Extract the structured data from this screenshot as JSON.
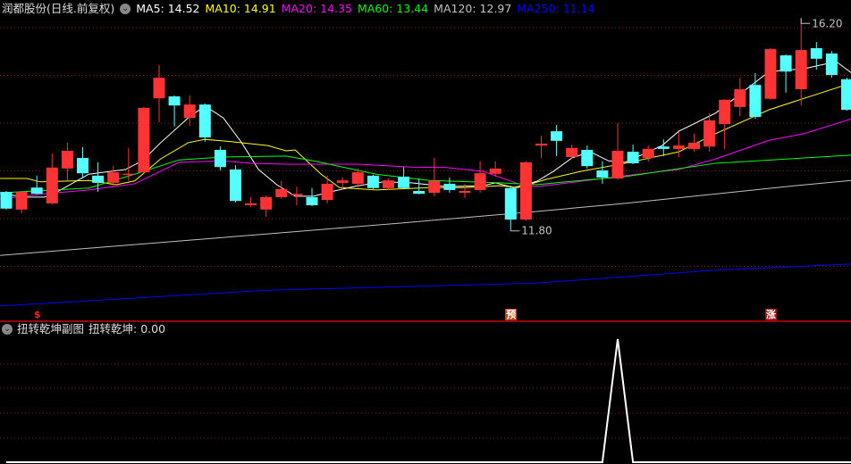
{
  "header": {
    "title": "润都股份(日线.前复权)",
    "ma": [
      {
        "label": "MA5: 14.52",
        "color": "#ffffff"
      },
      {
        "label": "MA10: 14.91",
        "color": "#ffff00"
      },
      {
        "label": "MA20: 14.35",
        "color": "#ff00ff"
      },
      {
        "label": "MA60: 13.44",
        "color": "#00ff00"
      },
      {
        "label": "MA120: 12.97",
        "color": "#c0c0c0"
      },
      {
        "label": "MA250: 11.14",
        "color": "#0000ff"
      }
    ]
  },
  "sub_header": {
    "title": "扭转乾坤副图",
    "value_label": "扭转乾坤: 0.00"
  },
  "markers": [
    {
      "text": "$",
      "index": 2,
      "color": "#ff2020",
      "bg": ""
    },
    {
      "text": "预",
      "index": 33,
      "color": "#ffffff",
      "bg": "#c04010"
    },
    {
      "text": "涨",
      "index": 50,
      "color": "#ffffff",
      "bg": "#a01010"
    }
  ],
  "colors": {
    "up": "#ff3333",
    "down": "#54ffff",
    "grid": "#8b1a1a",
    "separator": "#cc0000"
  },
  "chart_data": {
    "type": "candlestick",
    "price_range": [
      10.0,
      16.2
    ],
    "grid_prices": [
      16,
      15,
      14,
      13,
      12,
      11
    ],
    "annotations": [
      {
        "text": "16.20",
        "index": 52,
        "price": 16.2
      },
      {
        "text": "11.80",
        "index": 33,
        "price": 11.8
      }
    ],
    "ohlc": [
      [
        12.56,
        12.58,
        12.19,
        12.21
      ],
      [
        12.19,
        12.58,
        12.11,
        12.56
      ],
      [
        12.65,
        12.9,
        12.51,
        12.52
      ],
      [
        12.32,
        13.37,
        12.3,
        13.07
      ],
      [
        13.05,
        13.59,
        12.79,
        13.42
      ],
      [
        13.27,
        13.5,
        12.84,
        12.95
      ],
      [
        12.9,
        13.18,
        12.56,
        12.75
      ],
      [
        12.75,
        13.1,
        12.67,
        12.97
      ],
      [
        12.92,
        13.48,
        12.79,
        12.94
      ],
      [
        12.97,
        14.34,
        12.95,
        14.32
      ],
      [
        14.52,
        15.22,
        14.02,
        14.95
      ],
      [
        14.56,
        14.58,
        13.93,
        14.37
      ],
      [
        14.11,
        14.58,
        13.94,
        14.39
      ],
      [
        14.39,
        14.41,
        13.61,
        13.7
      ],
      [
        13.44,
        13.51,
        13.01,
        13.08
      ],
      [
        13.03,
        13.12,
        12.34,
        12.37
      ],
      [
        12.28,
        12.45,
        12.24,
        12.32
      ],
      [
        12.19,
        12.49,
        12.04,
        12.45
      ],
      [
        12.45,
        12.79,
        12.41,
        12.62
      ],
      [
        12.49,
        12.67,
        12.28,
        12.52
      ],
      [
        12.45,
        12.64,
        12.26,
        12.28
      ],
      [
        12.39,
        12.9,
        12.32,
        12.73
      ],
      [
        12.75,
        12.86,
        12.6,
        12.8
      ],
      [
        12.73,
        13.05,
        12.65,
        12.97
      ],
      [
        12.9,
        12.92,
        12.62,
        12.64
      ],
      [
        12.64,
        12.84,
        12.6,
        12.8
      ],
      [
        12.88,
        13.08,
        12.62,
        12.64
      ],
      [
        12.58,
        12.84,
        12.51,
        12.52
      ],
      [
        12.54,
        13.27,
        12.47,
        12.79
      ],
      [
        12.73,
        12.86,
        12.54,
        12.6
      ],
      [
        12.54,
        12.73,
        12.43,
        12.58
      ],
      [
        12.6,
        13.2,
        12.54,
        12.95
      ],
      [
        12.94,
        13.2,
        12.88,
        13.05
      ],
      [
        12.64,
        12.69,
        11.8,
        11.98
      ],
      [
        11.98,
        13.2,
        11.96,
        13.18
      ],
      [
        13.53,
        13.74,
        13.27,
        13.57
      ],
      [
        13.83,
        13.96,
        13.31,
        13.63
      ],
      [
        13.29,
        13.55,
        13.25,
        13.48
      ],
      [
        13.44,
        13.53,
        13.05,
        13.1
      ],
      [
        13.01,
        13.2,
        12.73,
        12.86
      ],
      [
        12.84,
        14.0,
        12.82,
        13.42
      ],
      [
        13.4,
        13.55,
        13.14,
        13.16
      ],
      [
        13.27,
        13.53,
        13.2,
        13.46
      ],
      [
        13.51,
        13.66,
        13.31,
        13.46
      ],
      [
        13.46,
        13.81,
        13.29,
        13.53
      ],
      [
        13.46,
        13.78,
        13.4,
        13.59
      ],
      [
        13.51,
        14.21,
        13.4,
        14.06
      ],
      [
        13.98,
        14.5,
        13.46,
        14.49
      ],
      [
        14.34,
        14.95,
        14.15,
        14.71
      ],
      [
        14.8,
        15.05,
        14.09,
        14.13
      ],
      [
        14.51,
        15.57,
        14.49,
        15.55
      ],
      [
        15.42,
        15.44,
        14.64,
        15.08
      ],
      [
        14.71,
        16.2,
        14.37,
        15.53
      ],
      [
        15.57,
        15.7,
        15.12,
        15.35
      ],
      [
        15.46,
        15.51,
        14.95,
        15.01
      ],
      [
        14.92,
        14.95,
        14.26,
        14.28
      ]
    ],
    "ma_lines": [
      {
        "name": "MA5",
        "color": "#ffffff",
        "points": [
          [
            -0.4,
            12.52
          ],
          [
            1.35,
            12.45
          ],
          [
            2.5,
            12.45
          ],
          [
            3.1,
            12.52
          ],
          [
            5.4,
            12.93
          ],
          [
            7.8,
            13.03
          ],
          [
            8.9,
            13.21
          ],
          [
            10.1,
            13.59
          ],
          [
            11.9,
            14.11
          ],
          [
            13.0,
            14.36
          ],
          [
            14.2,
            14.11
          ],
          [
            15.4,
            13.59
          ],
          [
            16.5,
            13.03
          ],
          [
            17.7,
            12.71
          ],
          [
            18.9,
            12.47
          ],
          [
            20.1,
            12.47
          ],
          [
            21.2,
            12.56
          ],
          [
            23.0,
            12.69
          ],
          [
            24.7,
            12.77
          ],
          [
            26.5,
            12.75
          ],
          [
            28.8,
            12.67
          ],
          [
            31.2,
            12.69
          ],
          [
            32.0,
            12.75
          ],
          [
            33.2,
            12.65
          ],
          [
            34.7,
            12.78
          ],
          [
            35.8,
            12.99
          ],
          [
            37.0,
            13.27
          ],
          [
            38.2,
            13.4
          ],
          [
            39.4,
            13.21
          ],
          [
            40.5,
            13.18
          ],
          [
            42.9,
            13.53
          ],
          [
            44.0,
            13.83
          ],
          [
            46.4,
            14.21
          ],
          [
            49.9,
            15.08
          ],
          [
            52.2,
            15.14
          ],
          [
            54.3,
            15.29
          ],
          [
            55.3,
            15.05
          ]
        ]
      },
      {
        "name": "MA10",
        "color": "#ffff00",
        "points": [
          [
            -0.4,
            12.84
          ],
          [
            1.35,
            12.84
          ],
          [
            2.2,
            12.77
          ],
          [
            5.4,
            12.8
          ],
          [
            7.2,
            12.71
          ],
          [
            8.4,
            12.79
          ],
          [
            10.1,
            13.25
          ],
          [
            11.9,
            13.59
          ],
          [
            13.0,
            13.66
          ],
          [
            14.8,
            13.61
          ],
          [
            17.1,
            13.53
          ],
          [
            18.3,
            13.42
          ],
          [
            18.9,
            13.44
          ],
          [
            20.6,
            12.93
          ],
          [
            21.8,
            12.65
          ],
          [
            24.2,
            12.6
          ],
          [
            27.7,
            12.65
          ],
          [
            30.0,
            12.65
          ],
          [
            32.3,
            12.69
          ],
          [
            33.5,
            12.65
          ],
          [
            35.3,
            12.82
          ],
          [
            37.6,
            12.99
          ],
          [
            40.5,
            13.16
          ],
          [
            44.0,
            13.4
          ],
          [
            46.4,
            13.78
          ],
          [
            49.9,
            14.28
          ],
          [
            52.2,
            14.52
          ],
          [
            55.3,
            14.84
          ]
        ]
      },
      {
        "name": "MA20",
        "color": "#ff00ff",
        "points": [
          [
            -0.4,
            12.41
          ],
          [
            2.5,
            12.52
          ],
          [
            5.4,
            12.6
          ],
          [
            8.4,
            12.73
          ],
          [
            11.3,
            13.18
          ],
          [
            14.2,
            13.21
          ],
          [
            16.0,
            13.16
          ],
          [
            18.3,
            13.14
          ],
          [
            23.0,
            13.14
          ],
          [
            26.5,
            13.08
          ],
          [
            28.8,
            13.07
          ],
          [
            31.2,
            12.99
          ],
          [
            33.5,
            12.73
          ],
          [
            34.7,
            12.67
          ],
          [
            35.8,
            12.71
          ],
          [
            40.5,
            12.9
          ],
          [
            44.0,
            13.03
          ],
          [
            46.4,
            13.25
          ],
          [
            49.9,
            13.64
          ],
          [
            52.2,
            13.78
          ],
          [
            55.3,
            14.09
          ]
        ]
      },
      {
        "name": "MA60",
        "color": "#00ff00",
        "points": [
          [
            -0.4,
            12.54
          ],
          [
            5.4,
            12.64
          ],
          [
            8.4,
            12.93
          ],
          [
            11.3,
            13.23
          ],
          [
            14.2,
            13.29
          ],
          [
            18.3,
            13.31
          ],
          [
            20.1,
            13.21
          ],
          [
            24.2,
            12.93
          ],
          [
            27.7,
            12.8
          ],
          [
            32.3,
            12.75
          ],
          [
            34.7,
            12.71
          ],
          [
            37.6,
            12.8
          ],
          [
            40.5,
            12.88
          ],
          [
            46.4,
            13.16
          ],
          [
            52.2,
            13.27
          ],
          [
            55.3,
            13.33
          ]
        ]
      },
      {
        "name": "MA120",
        "color": "#c0c0c0",
        "points": [
          [
            -0.4,
            11.23
          ],
          [
            17.1,
            11.68
          ],
          [
            25.9,
            11.91
          ],
          [
            34.7,
            12.15
          ],
          [
            40.5,
            12.32
          ],
          [
            51.6,
            12.69
          ],
          [
            55.3,
            12.8
          ]
        ]
      },
      {
        "name": "MA250",
        "color": "#0000ff",
        "points": [
          [
            -0.4,
            10.17
          ],
          [
            17.1,
            10.5
          ],
          [
            34.7,
            10.65
          ],
          [
            46.4,
            10.92
          ],
          [
            55.3,
            11.05
          ]
        ]
      }
    ],
    "sub_indicator": {
      "name": "扭转乾坤",
      "range": [
        0,
        1
      ],
      "values": [
        0,
        0,
        0,
        0,
        0,
        0,
        0,
        0,
        0,
        0,
        0,
        0,
        0,
        0,
        0,
        0,
        0,
        0,
        0,
        0,
        0,
        0,
        0,
        0,
        0,
        0,
        0,
        0,
        0,
        0,
        0,
        0,
        0,
        0,
        0,
        0,
        0,
        0,
        0,
        0,
        1,
        0,
        0,
        0,
        0,
        0,
        0,
        0,
        0,
        0,
        0,
        0,
        0,
        0,
        0,
        0
      ]
    }
  }
}
